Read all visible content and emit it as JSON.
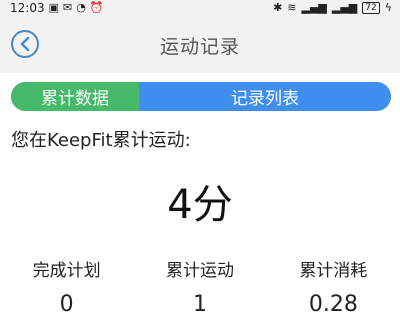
{
  "status_bar": {
    "time": "12:03",
    "left_icons": [
      "gallery-icon",
      "mail-icon",
      "speed-icon",
      "alarm-icon"
    ],
    "right_icons": [
      "bluetooth-icon",
      "wifi-icon",
      "signal-icon",
      "signal-icon"
    ],
    "battery": "72"
  },
  "header": {
    "title": "运动记录"
  },
  "tabs": [
    {
      "label": "累计数据",
      "color": "#46b96b",
      "active": true
    },
    {
      "label": "记录列表",
      "color": "#3f8ff0",
      "active": false
    }
  ],
  "summary": {
    "intro": "您在KeepFit累计运动:",
    "total": "4分"
  },
  "stats": [
    {
      "label": "完成计划",
      "value": "0"
    },
    {
      "label": "累计运动",
      "value": "1"
    },
    {
      "label": "累计消耗",
      "value": "0.28"
    }
  ],
  "colors": {
    "accent_blue": "#3f8ff0",
    "accent_green": "#46b96b",
    "back_button": "#4a86c8"
  }
}
